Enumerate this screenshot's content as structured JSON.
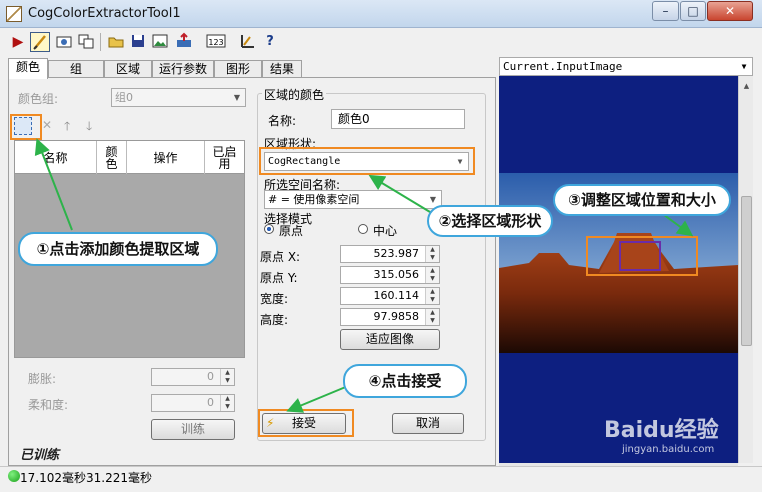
{
  "window": {
    "title": "CogColorExtractorTool1",
    "min": "–",
    "max": "□",
    "close": "✕"
  },
  "toolbar": {
    "icons": [
      "run-icon",
      "wand-icon",
      "camera-icon",
      "copy-icon",
      "open-folder-icon",
      "save-icon",
      "image-icon",
      "export-icon",
      "number-icon",
      "ruler-icon",
      "help-icon"
    ]
  },
  "tabs": [
    "颜色",
    "组",
    "区域",
    "运行参数",
    "图形",
    "结果"
  ],
  "left": {
    "color_group_label": "颜色组:",
    "color_group_value": "组0",
    "list_headers": [
      "名称",
      "颜色",
      "操作",
      "已启用"
    ],
    "dilate_label": "膨胀:",
    "dilate_value": "0",
    "softness_label": "柔和度:",
    "softness_value": "0",
    "train_button": "训练",
    "trained_label": "已训练"
  },
  "region": {
    "group_title": "区域的颜色",
    "name_label": "名称:",
    "name_value": "颜色0",
    "shape_label": "区域形状:",
    "shape_value": "CogRectangle",
    "space_label": "所选空间名称:",
    "space_value": "# = 使用像素空间",
    "mode_label": "选择模式",
    "mode_origin": "原点",
    "mode_center": "中心",
    "fields": [
      {
        "label": "原点 X:",
        "value": "523.987"
      },
      {
        "label": "原点 Y:",
        "value": "315.056"
      },
      {
        "label": "宽度:",
        "value": "160.114"
      },
      {
        "label": "高度:",
        "value": "97.9858"
      }
    ],
    "fit_button": "适应图像",
    "accept_button": "接受",
    "cancel_button": "取消"
  },
  "image": {
    "source": "Current.InputImage"
  },
  "callouts": {
    "c1": "①点击添加颜色提取区域",
    "c2": "②选择区域形状",
    "c3": "③调整区域位置和大小",
    "c4": "④点击接受"
  },
  "status": {
    "text": "17.102毫秒31.221毫秒"
  },
  "watermark": {
    "brand": "Baidu经验",
    "url": "jingyan.baidu.com"
  },
  "colors": {
    "accent_orange": "#f08a22",
    "callout_blue": "#3fa6dc",
    "arrow_green": "#2db34a",
    "image_bg": "#0d1f80"
  }
}
